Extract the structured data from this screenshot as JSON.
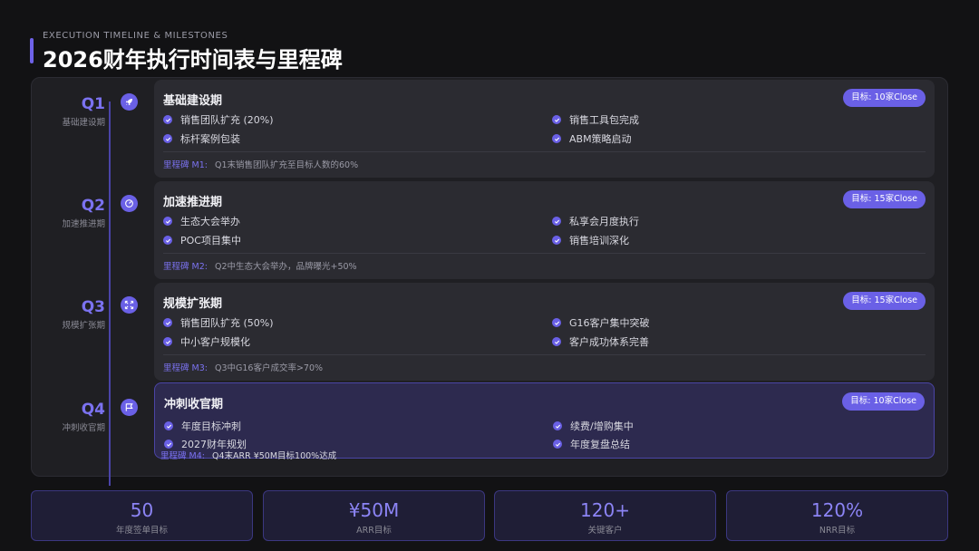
{
  "header": {
    "subtitle": "EXECUTION TIMELINE & MILESTONES",
    "title": "2026财年执行时间表与里程碑"
  },
  "colors": {
    "accent": "#6a60e6",
    "accent_text": "#7b72f0",
    "background": "#121214",
    "panel": "#1f1f23",
    "card": "#2b2b31",
    "active_card": "#2d2a4f"
  },
  "quarters": [
    {
      "name": "Q1",
      "subtitle": "基础建设期",
      "icon": "rocket-icon",
      "title": "基础建设期",
      "badge": "目标: 10家Close",
      "items": [
        "销售团队扩充 (20%)",
        "销售工具包完成",
        "标杆案例包装",
        "ABM策略启动"
      ],
      "milestone_label": "里程碑 M1:",
      "milestone_text": "Q1末销售团队扩充至目标人数的60%"
    },
    {
      "name": "Q2",
      "subtitle": "加速推进期",
      "icon": "gauge-icon",
      "title": "加速推进期",
      "badge": "目标: 15家Close",
      "items": [
        "生态大会举办",
        "私享会月度执行",
        "POC项目集中",
        "销售培训深化"
      ],
      "milestone_label": "里程碑 M2:",
      "milestone_text": "Q2中生态大会举办，品牌曝光+50%"
    },
    {
      "name": "Q3",
      "subtitle": "规模扩张期",
      "icon": "expand-icon",
      "title": "规模扩张期",
      "badge": "目标: 15家Close",
      "items": [
        "销售团队扩充 (50%)",
        "G16客户集中突破",
        "中小客户规模化",
        "客户成功体系完善"
      ],
      "milestone_label": "里程碑 M3:",
      "milestone_text": "Q3中G16客户成交率>70%"
    },
    {
      "name": "Q4",
      "subtitle": "冲刺收官期",
      "icon": "flag-icon",
      "title": "冲刺收官期",
      "badge": "目标: 10家Close",
      "items": [
        "年度目标冲刺",
        "续费/增购集中",
        "2027财年规划",
        "年度复盘总结"
      ],
      "milestone_label": "里程碑 M4:",
      "milestone_text": "Q4末ARR ¥50M目标100%达成"
    }
  ],
  "stats": [
    {
      "value": "50",
      "label": "年度签单目标"
    },
    {
      "value": "¥50M",
      "label": "ARR目标"
    },
    {
      "value": "120+",
      "label": "关键客户"
    },
    {
      "value": "120%",
      "label": "NRR目标"
    }
  ]
}
